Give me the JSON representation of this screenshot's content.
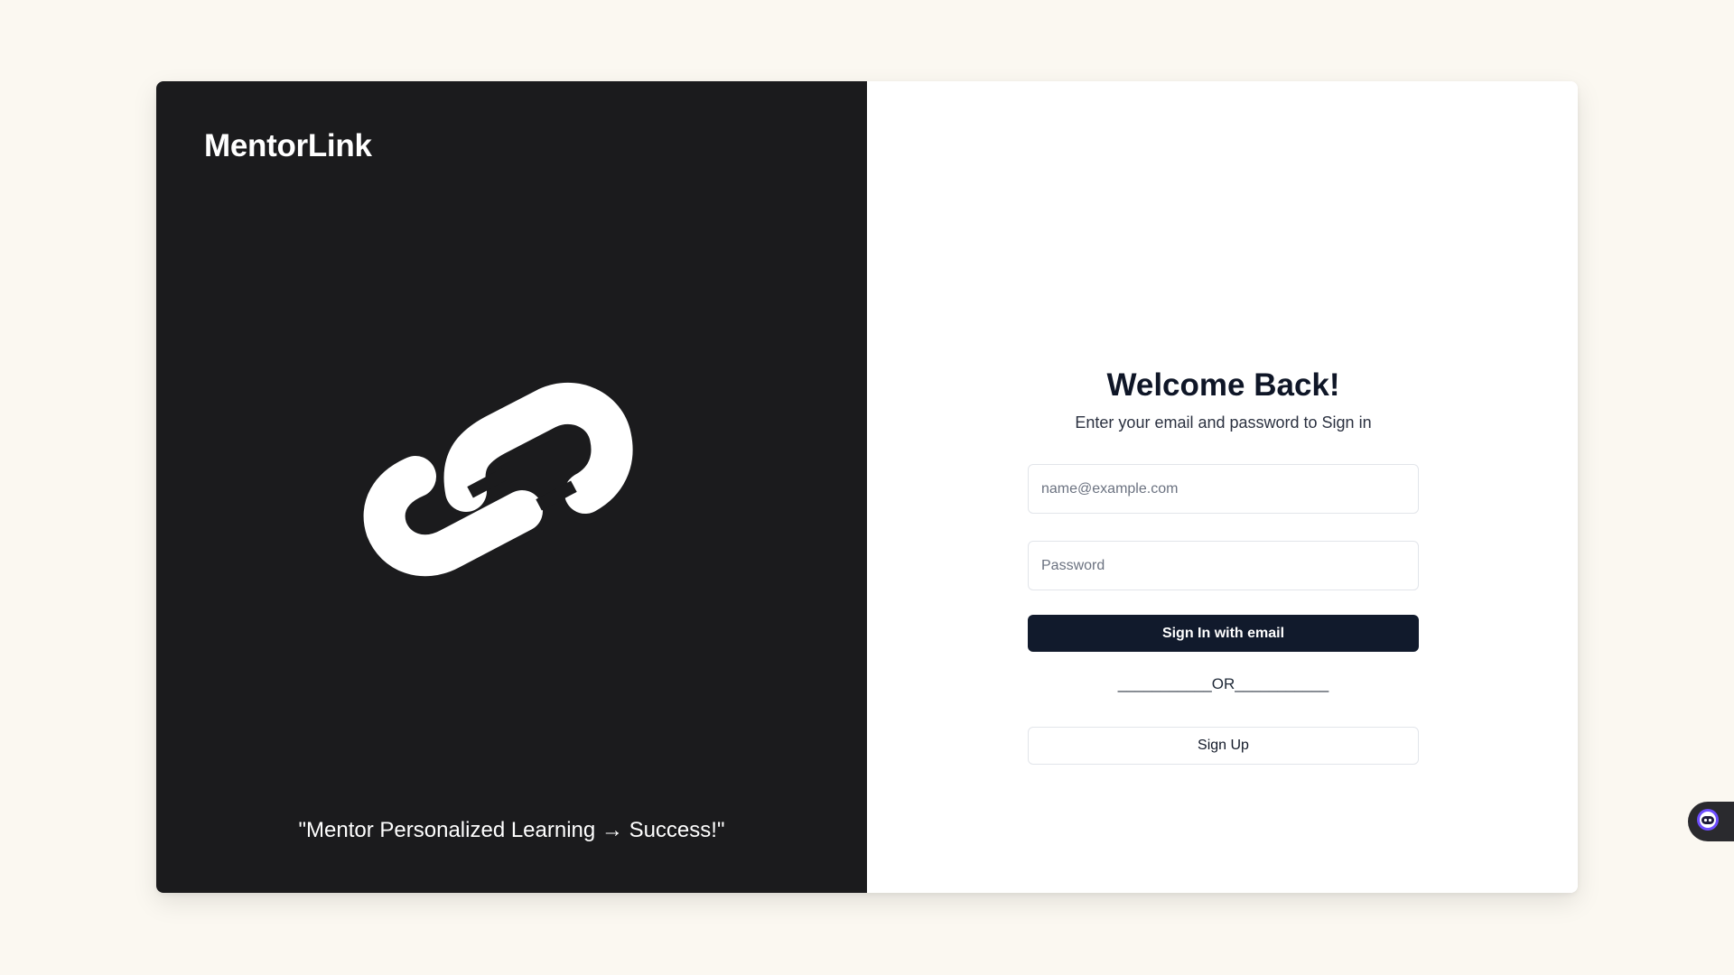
{
  "brand": {
    "name": "MentorLink",
    "logo_icon": "chain-link-icon"
  },
  "tagline": "\"Mentor Personalized Learning → Success!\"",
  "login": {
    "title": "Welcome Back!",
    "subtitle": "Enter your email and password to Sign in",
    "email_placeholder": "name@example.com",
    "email_value": "",
    "password_placeholder": "Password",
    "password_value": "",
    "sign_in_label": "Sign In with email",
    "divider_text": "___________OR___________",
    "sign_up_label": "Sign Up"
  },
  "assistant_widget": {
    "icon": "assistant-bot-icon"
  },
  "colors": {
    "page_background": "#fbf8f1",
    "left_panel": "#1b1b1d",
    "primary_button": "#111a2c",
    "bot_accent": "#6d4dff"
  }
}
